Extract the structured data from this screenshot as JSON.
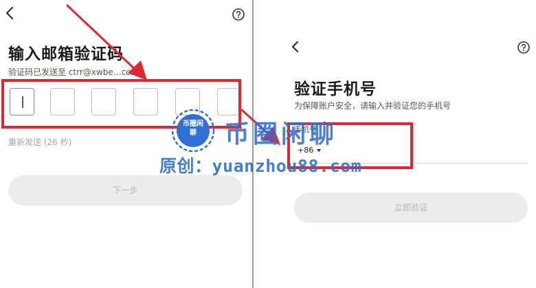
{
  "left_screen": {
    "title": "输入邮箱验证码",
    "subtitle": "验证码已发送至 ctrr@xwbe…com",
    "code_box_count": 6,
    "resend_text": "重新发送 (26 秒)",
    "next_button_label": "下一步"
  },
  "right_screen": {
    "title": "验证手机号",
    "subtitle": "为保障账户安全，请输入并验证您的手机号",
    "phone_label": "手机号",
    "country_code": "+86",
    "verify_button_label": "立即验证"
  },
  "watermark": {
    "logo_text": "币圈闲聊",
    "brand_text": "币圈闲聊",
    "url_text": "原创：yuanzhou88.com"
  },
  "colors": {
    "highlight": "#e0262e",
    "watermark": "#2f6fd6",
    "button_bg": "#ececec",
    "button_text": "#b5b5b5"
  },
  "icons": {
    "back": "chevron-left-icon",
    "help": "question-circle-icon",
    "dropdown": "caret-down-icon"
  }
}
